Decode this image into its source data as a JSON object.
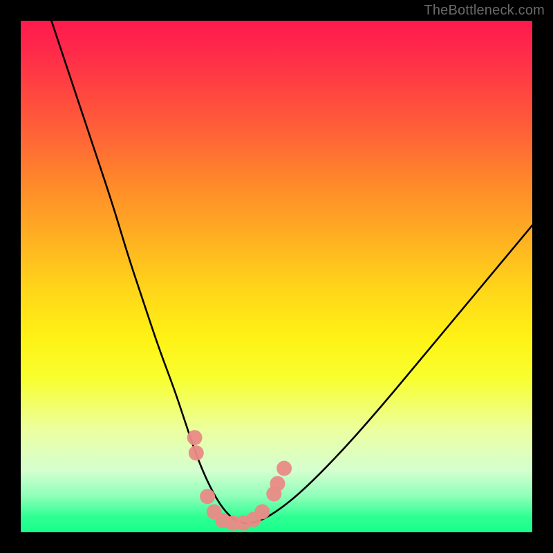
{
  "watermark": "TheBottleneck.com",
  "chart_data": {
    "type": "line",
    "title": "",
    "xlabel": "",
    "ylabel": "",
    "xlim": [
      0,
      100
    ],
    "ylim": [
      0,
      100
    ],
    "gradient_stops": [
      {
        "pos": 0,
        "color": "#ff1a4d"
      },
      {
        "pos": 24,
        "color": "#ff6a35"
      },
      {
        "pos": 52,
        "color": "#ffd41a"
      },
      {
        "pos": 80,
        "color": "#ecffa0"
      },
      {
        "pos": 100,
        "color": "#18ff8a"
      }
    ],
    "series": [
      {
        "name": "main-curve",
        "x": [
          6,
          10,
          14,
          18,
          21,
          24,
          27,
          30,
          32,
          34,
          36,
          38,
          40,
          42.5,
          46,
          50,
          55,
          62,
          70,
          80,
          90,
          100
        ],
        "y": [
          100,
          88,
          76,
          64,
          54,
          45,
          36,
          28,
          22,
          16,
          11,
          7,
          4,
          1.8,
          1.8,
          4,
          8,
          15,
          24,
          36,
          48,
          60
        ]
      },
      {
        "name": "marker-cluster",
        "type": "scatter",
        "color": "#e98b86",
        "points": [
          {
            "x": 34.0,
            "y": 18.5
          },
          {
            "x": 34.3,
            "y": 15.5
          },
          {
            "x": 36.5,
            "y": 7.0
          },
          {
            "x": 37.8,
            "y": 4.0
          },
          {
            "x": 39.5,
            "y": 2.3
          },
          {
            "x": 41.5,
            "y": 1.8
          },
          {
            "x": 43.5,
            "y": 1.8
          },
          {
            "x": 45.5,
            "y": 2.5
          },
          {
            "x": 47.2,
            "y": 4.0
          },
          {
            "x": 49.5,
            "y": 7.5
          },
          {
            "x": 50.2,
            "y": 9.5
          },
          {
            "x": 51.5,
            "y": 12.5
          }
        ]
      }
    ]
  }
}
